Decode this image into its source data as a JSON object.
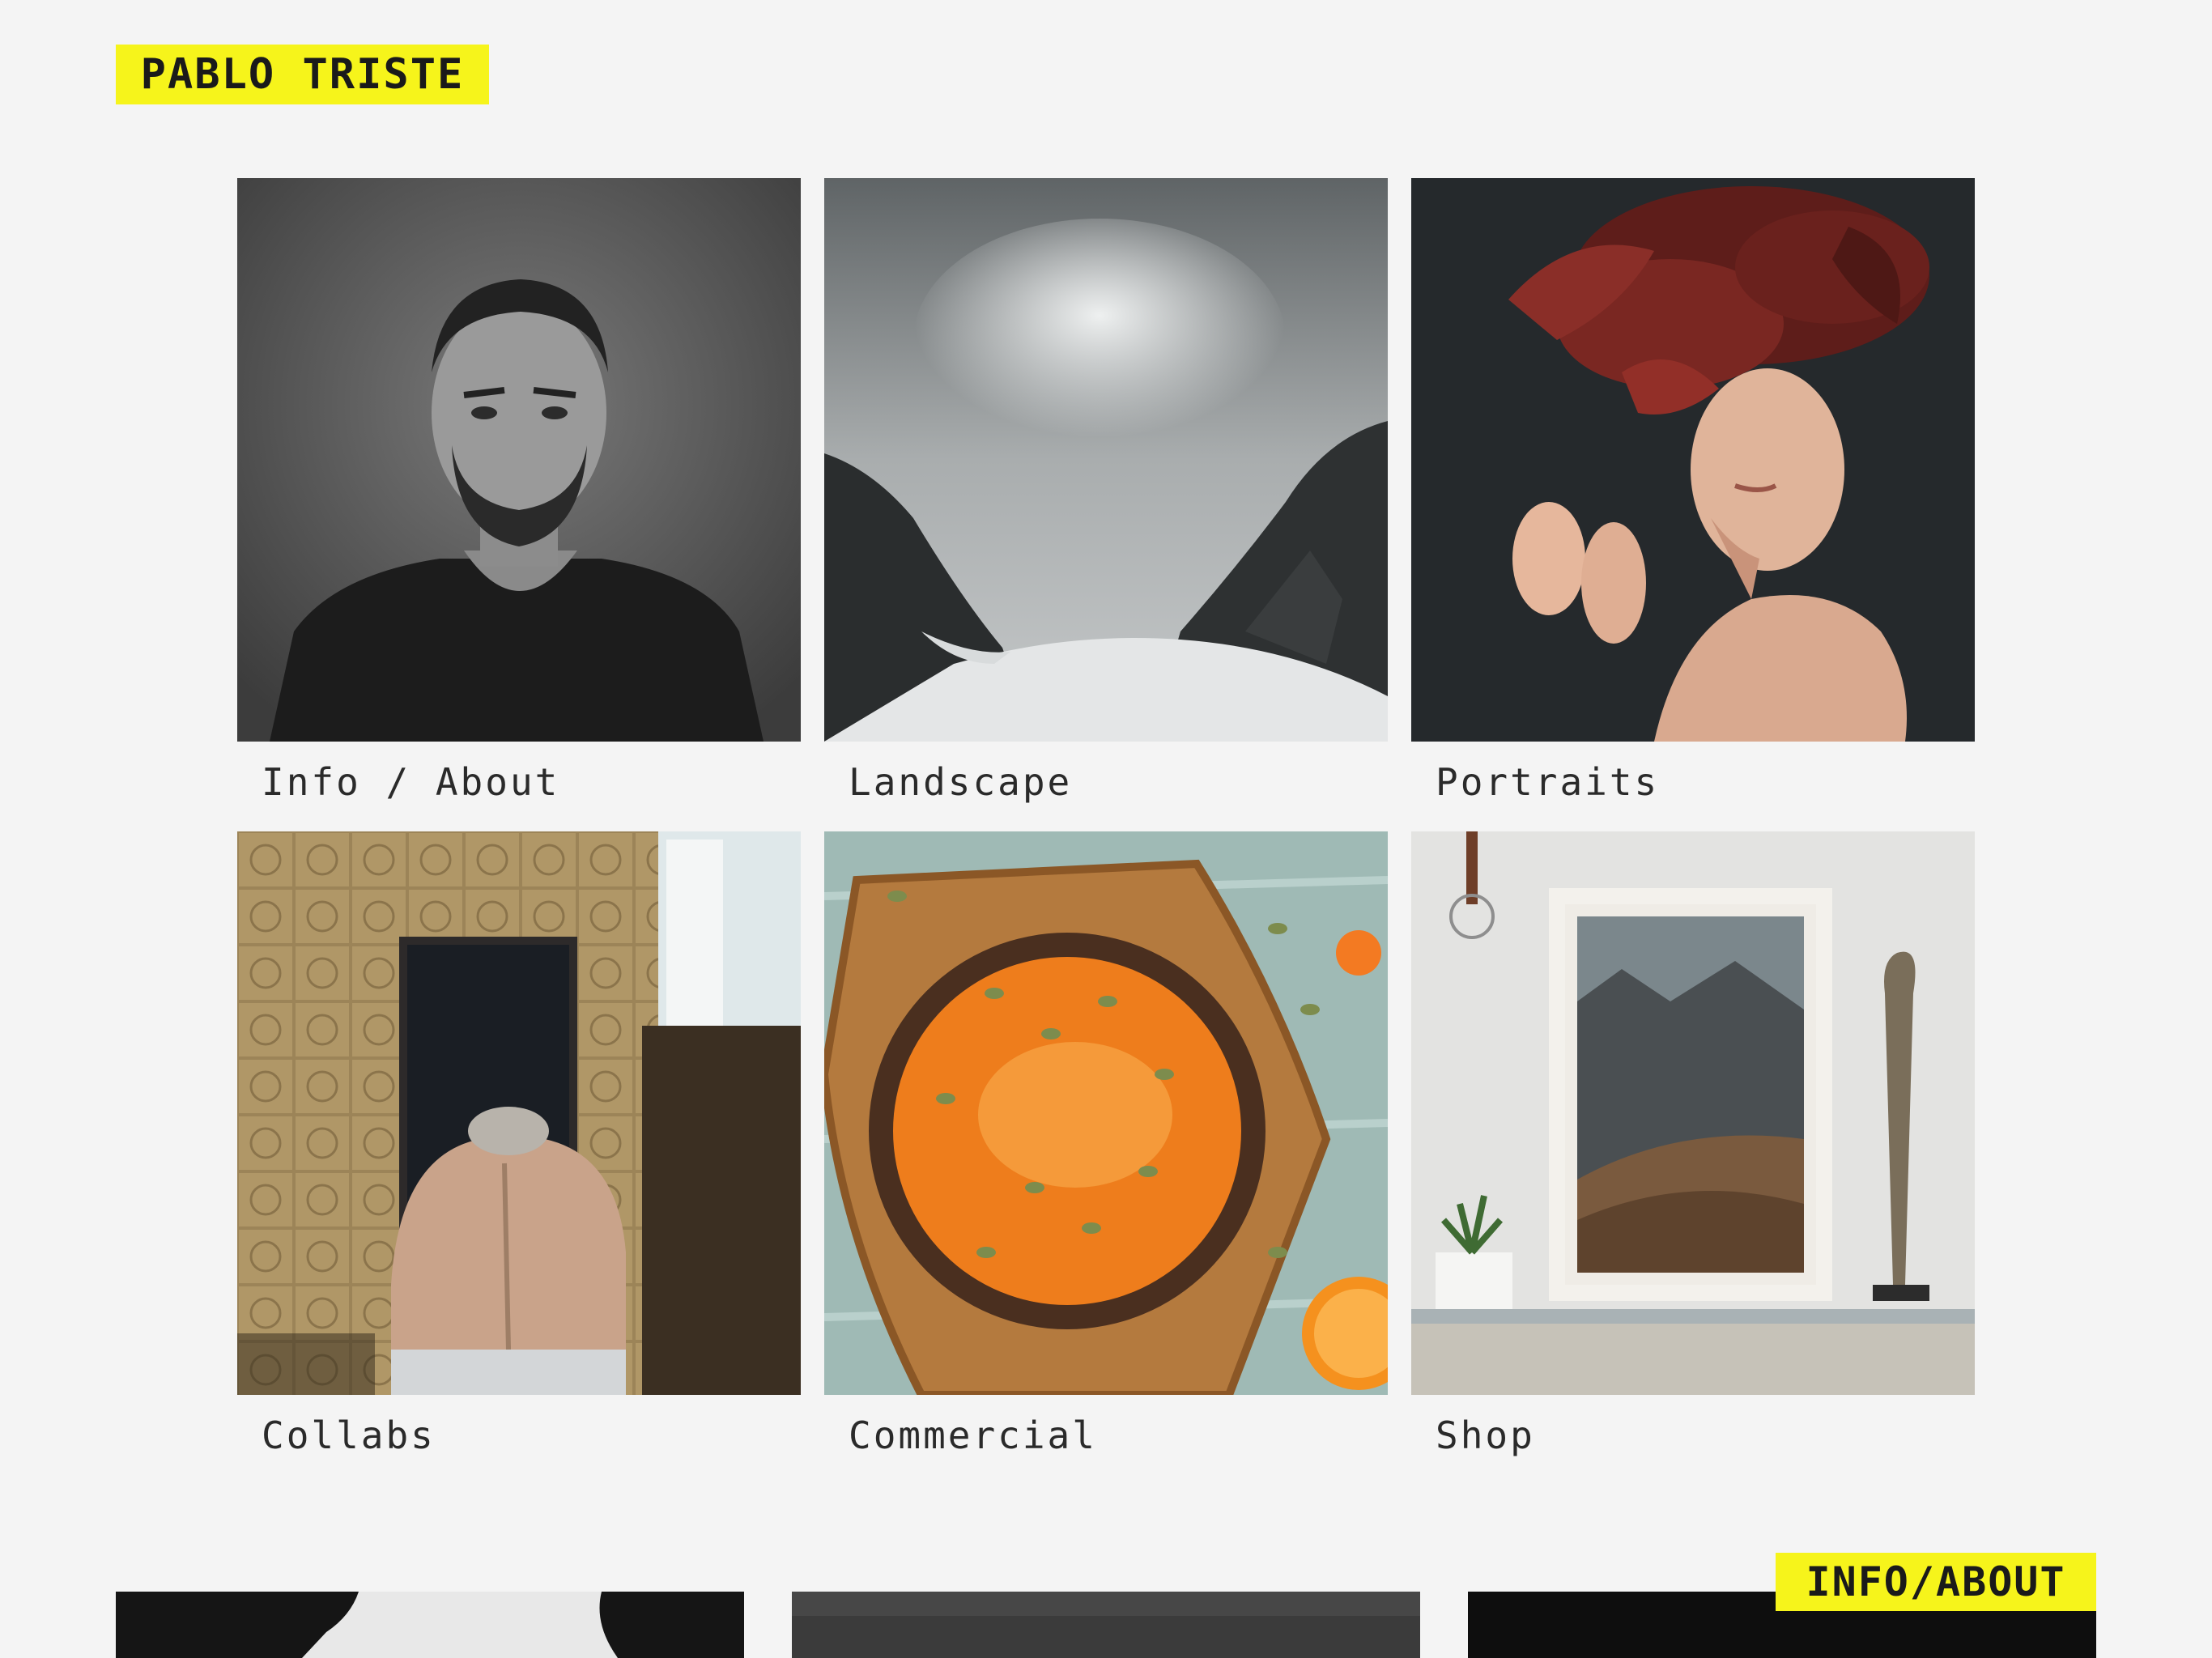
{
  "header": {
    "brand": "PABLO TRISTE"
  },
  "gallery": {
    "items": [
      {
        "label": "Info / About",
        "image": "portrait-man-bw"
      },
      {
        "label": "Landscape",
        "image": "mountain-valley-bw"
      },
      {
        "label": "Portraits",
        "image": "woman-flower-headdress"
      },
      {
        "label": "Collabs",
        "image": "man-back-bathroom"
      },
      {
        "label": "Commercial",
        "image": "pumpkin-soup-bowl"
      },
      {
        "label": "Shop",
        "image": "framed-mountain-print"
      }
    ]
  },
  "footer_badge": {
    "label": "INFO/ABOUT"
  },
  "colors": {
    "accent": "#f6f41b",
    "background": "#f4f4f4",
    "text": "#2a2a2a"
  }
}
